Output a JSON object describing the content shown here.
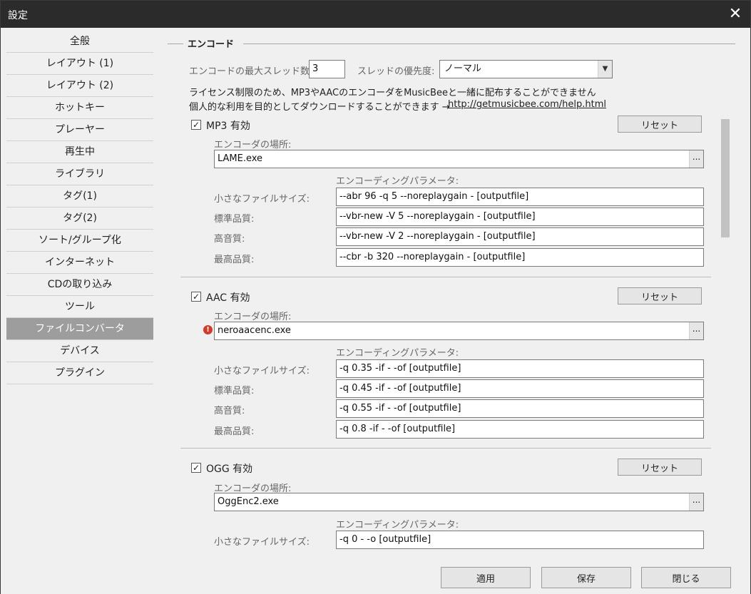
{
  "window": {
    "title": "設定",
    "close_glyph": "✕"
  },
  "sidebar": {
    "items": [
      {
        "label": "全般"
      },
      {
        "label": "レイアウト (1)"
      },
      {
        "label": "レイアウト (2)"
      },
      {
        "label": "ホットキー"
      },
      {
        "label": "プレーヤー"
      },
      {
        "label": "再生中"
      },
      {
        "label": "ライブラリ"
      },
      {
        "label": "タグ(1)"
      },
      {
        "label": "タグ(2)"
      },
      {
        "label": "ソート/グループ化"
      },
      {
        "label": "インターネット"
      },
      {
        "label": "CDの取り込み"
      },
      {
        "label": "ツール"
      },
      {
        "label": "ファイルコンバータ"
      },
      {
        "label": "デバイス"
      },
      {
        "label": "プラグイン"
      }
    ],
    "selected_index": 13
  },
  "encode": {
    "section_title": "エンコード",
    "max_threads_label": "エンコードの最大スレッド数:",
    "max_threads_value": "3",
    "priority_label": "スレッドの優先度:",
    "priority_value": "ノーマル",
    "license_line1": "ライセンス制限のため、MP3やAACのエンコーダをMusicBeeと一緒に配布することができません",
    "license_line2": "個人的な利用を目的としてダウンロードすることができます →",
    "help_link": "http://getmusicbee.com/help.html"
  },
  "common": {
    "reset_label": "リセット",
    "encoder_location_label": "エンコーダの場所:",
    "encoding_params_label": "エンコーディングパラメータ:",
    "browse_glyph": "...",
    "check_glyph": "✓",
    "error_glyph": "!",
    "quality_labels": [
      "小さなファイルサイズ:",
      "標準品質:",
      "高音質:",
      "最高品質:"
    ]
  },
  "encoders": [
    {
      "enabled_label": "MP3 有効",
      "checked": true,
      "location": "LAME.exe",
      "params": [
        "--abr 96 -q 5 --noreplaygain - [outputfile]",
        "--vbr-new -V 5 --noreplaygain - [outputfile]",
        "--vbr-new -V 2 --noreplaygain - [outputfile]",
        "--cbr -b 320 --noreplaygain - [outputfile]"
      ]
    },
    {
      "enabled_label": "AAC 有効",
      "checked": true,
      "location": "neroaacenc.exe",
      "error": true,
      "params": [
        "-q 0.35 -if - -of [outputfile]",
        "-q 0.45 -if - -of [outputfile]",
        "-q 0.55 -if - -of [outputfile]",
        "-q 0.8 -if - -of [outputfile]"
      ]
    },
    {
      "enabled_label": "OGG 有効",
      "checked": true,
      "location": "OggEnc2.exe",
      "params": [
        "-q 0 - -o [outputfile]"
      ]
    }
  ],
  "footer": {
    "apply_label": "適用",
    "save_label": "保存",
    "close_label": "閉じる"
  },
  "colors": {
    "titlebar": "#2b2b2b",
    "selected_nav": "#9d9d9d",
    "error": "#d33a2a"
  }
}
